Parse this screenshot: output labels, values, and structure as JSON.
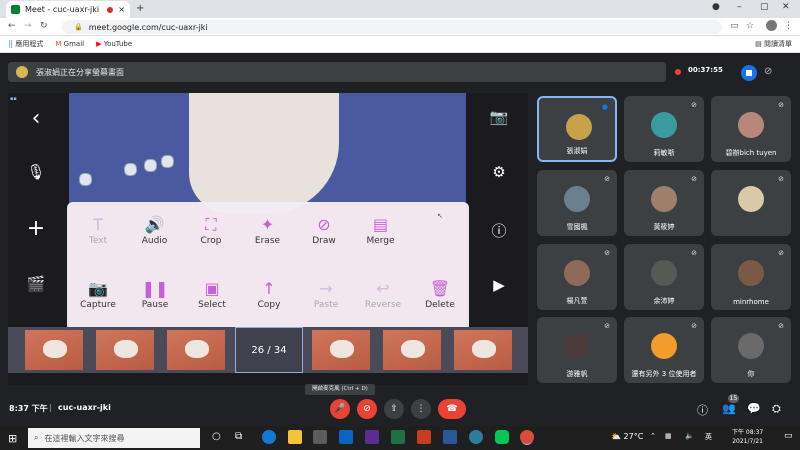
{
  "browser": {
    "tab_title": "Meet - cuc-uaxr-jki",
    "url": "meet.google.com/cuc-uaxr-jki",
    "bookmarks": [
      "應用程式",
      "Gmail",
      "YouTube"
    ],
    "reading_list": "閱讀清單",
    "new_tab": "+"
  },
  "meet": {
    "presenting_banner": "張淑娟正在分享螢幕畫面",
    "recording_time": "00:37:55",
    "clock": "8:37 下午",
    "meeting_code": "cuc-uaxr-jki",
    "mic_tooltip": "開啟麥克風 (Ctrl + D)",
    "participant_count": "15"
  },
  "editor": {
    "tools_row1": [
      {
        "label": "Text",
        "icon": "text-icon",
        "glyph": "T",
        "enabled": false
      },
      {
        "label": "Audio",
        "icon": "audio-icon",
        "glyph": "🔊",
        "enabled": true
      },
      {
        "label": "Crop",
        "icon": "crop-icon",
        "glyph": "⛶",
        "enabled": true
      },
      {
        "label": "Erase",
        "icon": "erase-icon",
        "glyph": "✦",
        "enabled": true
      },
      {
        "label": "Draw",
        "icon": "draw-icon",
        "glyph": "⊘",
        "enabled": true
      },
      {
        "label": "Merge",
        "icon": "merge-icon",
        "glyph": "▤",
        "enabled": true
      }
    ],
    "tools_row2": [
      {
        "label": "Capture",
        "icon": "capture-icon",
        "glyph": "📷",
        "enabled": true
      },
      {
        "label": "Pause",
        "icon": "pause-icon",
        "glyph": "❚❚",
        "enabled": true
      },
      {
        "label": "Select",
        "icon": "select-icon",
        "glyph": "▣",
        "enabled": true
      },
      {
        "label": "Copy",
        "icon": "copy-icon",
        "glyph": "↑",
        "enabled": true
      },
      {
        "label": "Paste",
        "icon": "paste-icon",
        "glyph": "→",
        "enabled": false
      },
      {
        "label": "Reverse",
        "icon": "reverse-icon",
        "glyph": "↩",
        "enabled": false
      },
      {
        "label": "Delete",
        "icon": "delete-icon",
        "glyph": "🗑",
        "enabled": true
      }
    ],
    "page_indicator": "26 / 34"
  },
  "participants": [
    {
      "name": "張淑娟",
      "color": "#c7a24a",
      "active": true
    },
    {
      "name": "莉敏哳",
      "color": "#3a9aa0",
      "active": false
    },
    {
      "name": "碧辦bich tuyen",
      "color": "#b9877a",
      "active": false
    },
    {
      "name": "雪國楓",
      "color": "#6b7f8f",
      "active": false
    },
    {
      "name": "黃筱婷",
      "color": "#a07f6a",
      "active": false
    },
    {
      "name": "",
      "color": "#d9c9a6",
      "active": false
    },
    {
      "name": "楊凡萱",
      "color": "#8f6a5a",
      "active": false
    },
    {
      "name": "余沛婷",
      "color": "#555a55",
      "active": false
    },
    {
      "name": "minrhome",
      "color": "#7a5a45",
      "active": false
    },
    {
      "name": "游雅帆",
      "color": "#4a3a3a",
      "active": false
    },
    {
      "name": "還有另外 3 位使用者",
      "color": "#f29d2a",
      "active": false
    },
    {
      "name": "你",
      "color": "#6a6a6a",
      "active": false
    }
  ],
  "taskbar": {
    "search_placeholder": "在這裡輸入文字來搜尋",
    "weather": "27°C",
    "time": "下午 08:37",
    "date": "2021/7/21"
  }
}
